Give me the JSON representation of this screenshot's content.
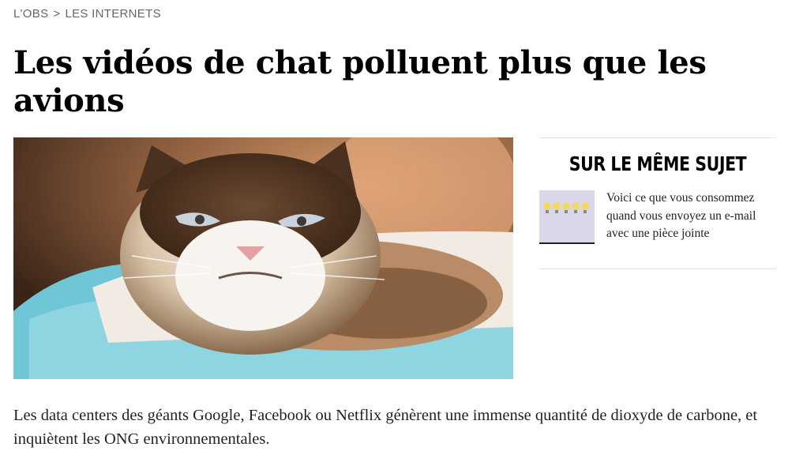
{
  "breadcrumb": {
    "section": "L'OBS",
    "separator": ">",
    "subsection": "LES INTERNETS"
  },
  "article": {
    "title": "Les vidéos de chat polluent plus que les avions",
    "lead": "Les data centers des géants Google, Facebook ou Netflix génèrent une immense quantité de dioxyde de carbone, et inquiètent les ONG environnementales."
  },
  "related": {
    "heading": "SUR LE MÊME SUJET",
    "items": [
      {
        "title": "Voici ce que vous consommez quand vous envoyez un e-mail avec une pièce jointe"
      }
    ]
  },
  "colors": {
    "text": "#111111",
    "muted": "#666666",
    "divider": "#e2e2e2",
    "cushion": "#6fc6d6"
  }
}
